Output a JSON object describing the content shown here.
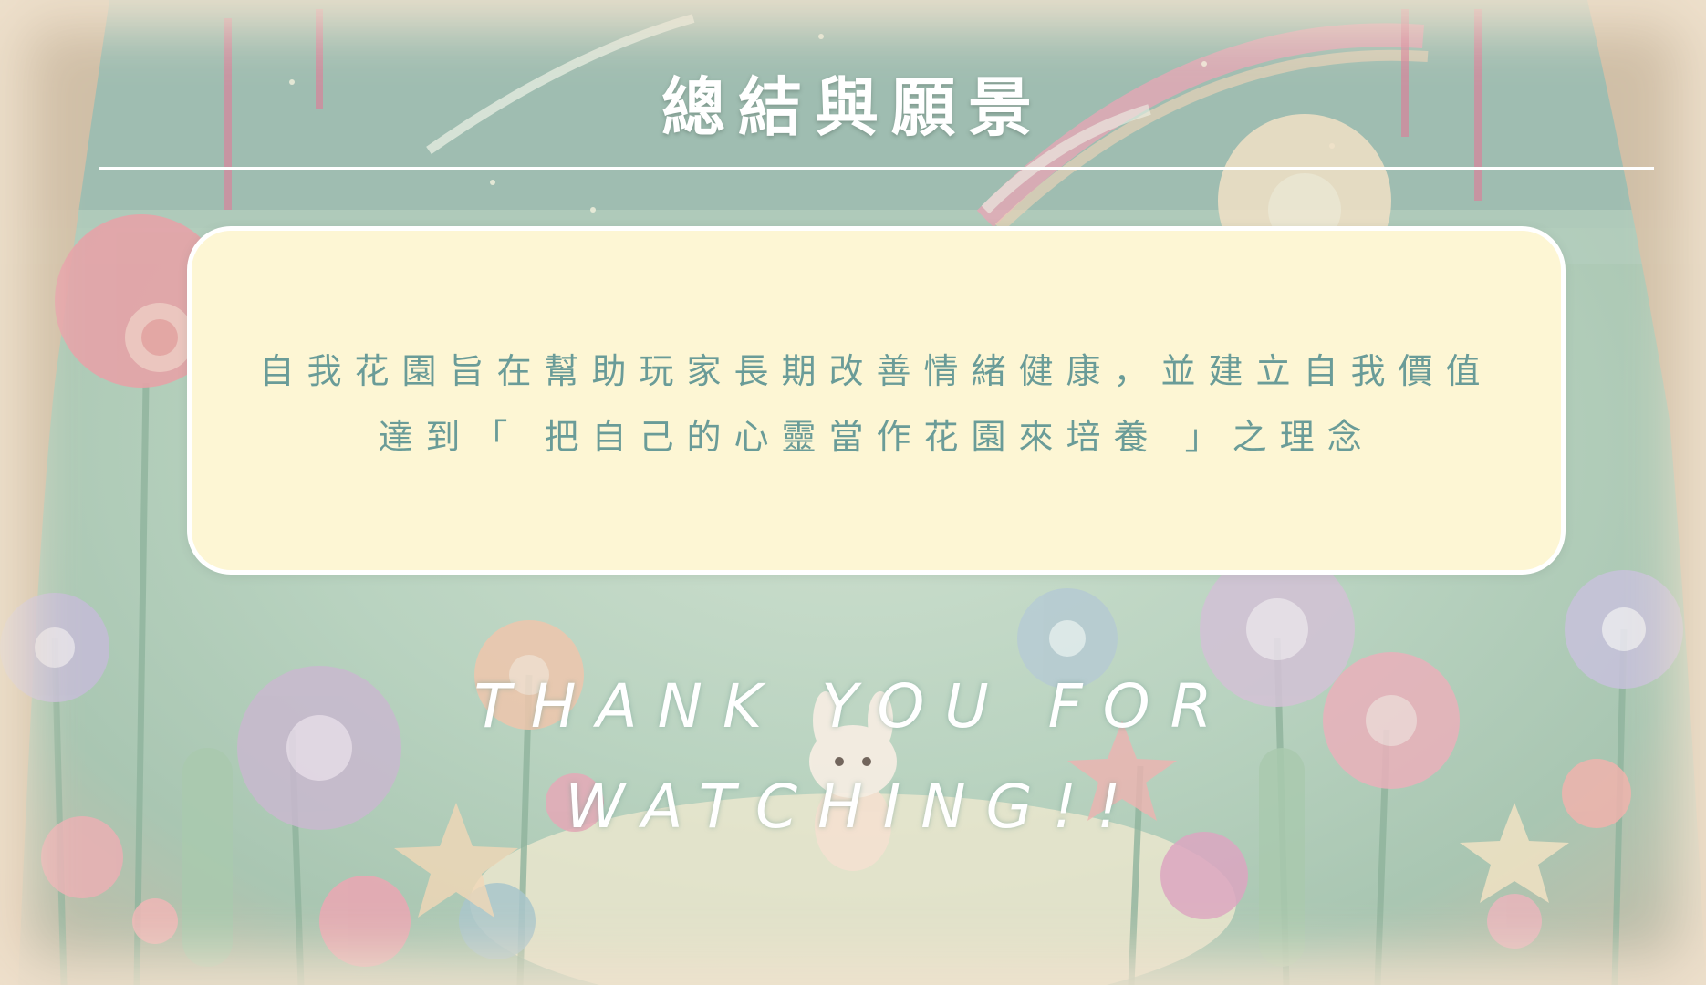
{
  "slide": {
    "title": "總結與願景",
    "body_lines": [
      "自我花園旨在幫助玩家長期改善情緒健康，並建立自我價值",
      "達到「 把自己的心靈當作花園來培養 」之理念"
    ],
    "closing_lines": [
      "THANK YOU FOR",
      "WATCHING!!"
    ]
  },
  "colors": {
    "card_background": "#fdf6d4",
    "body_text": "#6a9c98",
    "title_text": "#ffffff",
    "rule": "#ffffff"
  }
}
